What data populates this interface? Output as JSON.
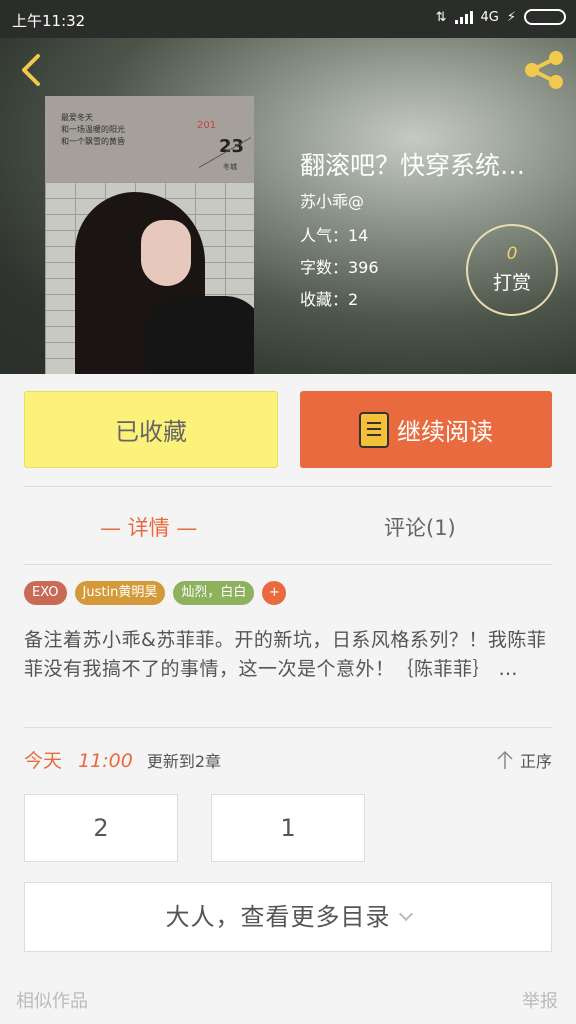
{
  "statusbar": {
    "time": "上午11:32",
    "network": "4G"
  },
  "book": {
    "title": "翻滚吧？快穿系统…",
    "author": "苏小乖@",
    "popularity": "人气：14",
    "words": "字数：396",
    "favorites": "收藏：2",
    "reward_count": "0",
    "reward_label": "打赏"
  },
  "cover": {
    "poem_line1": "最爱冬天",
    "poem_line2": "和一场温暖的阳光",
    "poem_line3": "和一个飘雪的黄昏",
    "num1": "201",
    "num2": "23",
    "small": "冬城"
  },
  "actions": {
    "collected": "已收藏",
    "continue_read": "继续阅读"
  },
  "tabs": {
    "detail": "— 详情 —",
    "comment": "评论(1)"
  },
  "tags": [
    {
      "label": "EXO",
      "color": "#c86a55"
    },
    {
      "label": "Justin黄明昊",
      "color": "#d49a3a"
    },
    {
      "label": "灿烈，白白",
      "color": "#8db15c"
    },
    {
      "label": "+",
      "color": "#e96a3e"
    }
  ],
  "description": "备注着苏小乖&苏菲菲。开的新坑，日系风格系列？！我陈菲菲没有我搞不了的事情，这一次是个意外！｛陈菲菲｝ …",
  "update": {
    "today": "今天",
    "time": "11:00",
    "text": "更新到2章",
    "order": "正序"
  },
  "chapters": [
    "2",
    "1"
  ],
  "more": "大人，查看更多目录",
  "footer": {
    "similar": "相似作品",
    "report": "举报"
  },
  "colors": {
    "accent": "#e96a3e",
    "collect_bg": "#fcf27a"
  }
}
